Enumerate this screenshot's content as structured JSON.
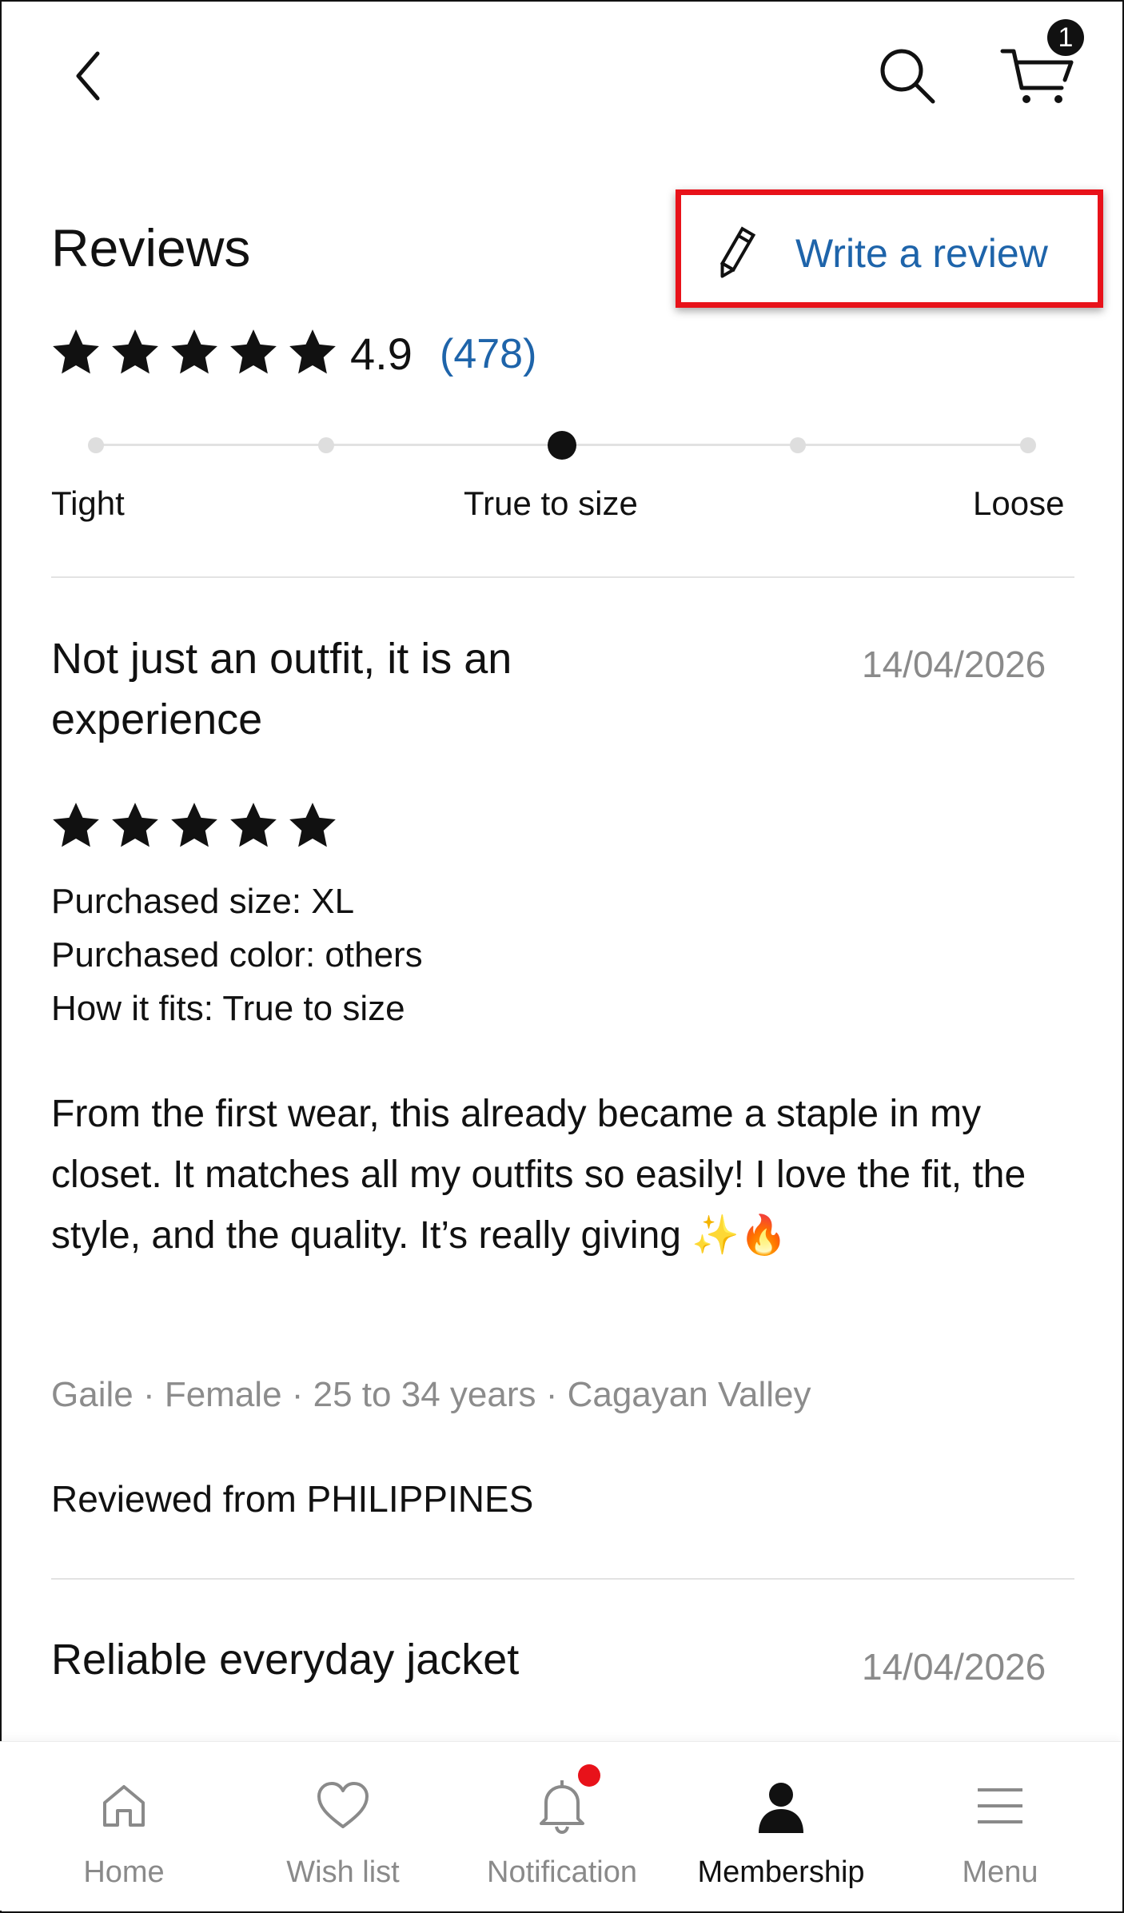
{
  "top_bar": {
    "cart_count": "1",
    "icons": [
      "back-chevron-icon",
      "search-icon",
      "cart-icon"
    ]
  },
  "reviews_header": {
    "title": "Reviews",
    "write_review_label": "Write a review",
    "highlight_color": "#e8121a",
    "link_color": "#1e64aa"
  },
  "rating_summary": {
    "stars": 5,
    "average": "4.9",
    "count": "(478)"
  },
  "fit_scale": {
    "labels": {
      "left": "Tight",
      "center": "True to size",
      "right": "Loose"
    },
    "steps": 5,
    "selected_index": 2
  },
  "reviews": [
    {
      "title": "Not just an outfit, it is an experience",
      "date": "14/04/2026",
      "stars": 5,
      "purchased_size": "Purchased size: XL",
      "purchased_color": "Purchased color: others",
      "fit": "How it fits: True to size",
      "body": "From the first wear, this already became a staple in my closet. It matches all my outfits so easily! I love the fit, the style, and the quality. It’s really giving ✨🔥",
      "author": "Gaile · Female · 25 to 34 years · Cagayan Valley",
      "reviewed_from": "Reviewed from PHILIPPINES"
    },
    {
      "title": "Reliable everyday jacket",
      "date": "14/04/2026"
    }
  ],
  "bottom_nav": {
    "items": [
      {
        "label": "Home",
        "icon": "home-icon"
      },
      {
        "label": "Wish list",
        "icon": "heart-icon"
      },
      {
        "label": "Notification",
        "icon": "bell-icon"
      },
      {
        "label": "Membership",
        "icon": "user-icon"
      },
      {
        "label": "Menu",
        "icon": "menu-icon"
      }
    ],
    "active": "Membership",
    "notification_dot_color": "#e8121a"
  }
}
